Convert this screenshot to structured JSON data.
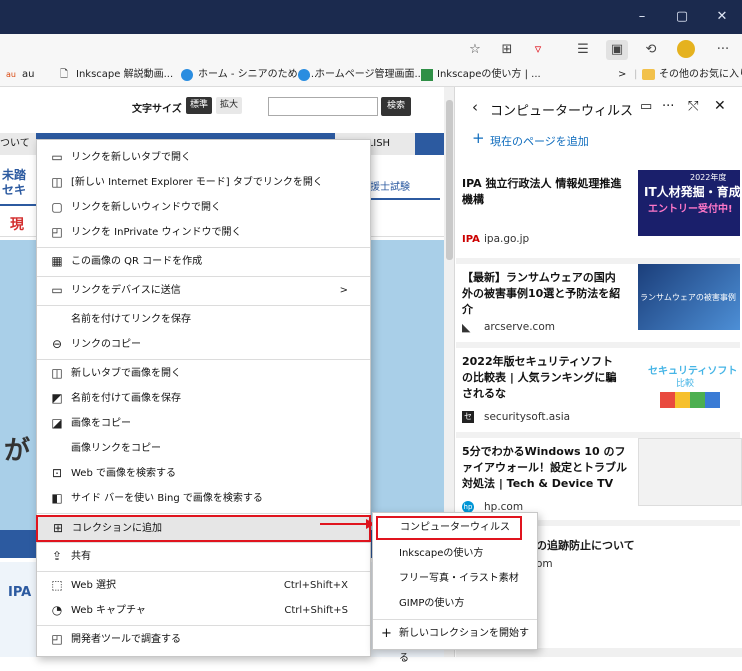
{
  "titlebar": {
    "minimize": "–",
    "restore": "▢",
    "close": "✕"
  },
  "toolbar": {
    "icons": [
      "favorite-star-icon",
      "apps-icon",
      "pocket-icon",
      "favorites-list-icon",
      "collections-icon",
      "history-icon",
      "profile-icon",
      "more-icon"
    ],
    "more": "···"
  },
  "favorites": {
    "items": [
      {
        "label": "au"
      },
      {
        "label": "Inkscape 解説動画..."
      },
      {
        "label": "ホーム - シニアのための..."
      },
      {
        "label": "ホームページ管理画面..."
      },
      {
        "label": "Inkscapeの使い方 | ..."
      }
    ],
    "chevron": ">",
    "other": "その他のお気に入り"
  },
  "page": {
    "font_size_label": "文字サイズ",
    "std": "標準",
    "large": "拡大",
    "search": "検索",
    "nav_left": "ついて",
    "nav_english": "ENGLISH",
    "left_frag1": "未踏",
    "left_frag2": "セキ",
    "left_frag3": "現",
    "left_frag4": "が",
    "right_frag1": "GLISH",
    "right_frag2": "援士試験",
    "ipa_frag": "IPA"
  },
  "panel": {
    "title": "コンピューターウィルス",
    "add_page": "現在のページを追加",
    "cards": [
      {
        "title": "IPA 独立行政法人 情報処理推進機構",
        "source": "ipa.go.jp",
        "img_text1": "2022年度",
        "img_text2": "IT人材発掘・育成",
        "img_text3": "エントリー受付中!"
      },
      {
        "title": "【最新】ランサムウェアの国内外の被害事例10選と予防法を紹介",
        "source": "arcserve.com",
        "img_text1": "ランサムウェアの被害事例"
      },
      {
        "title": "2022年版セキュリティソフトの比較表 | 人気ランキングに騙されるな",
        "source": "securitysoft.asia",
        "img_text1": "セキュリティソフト",
        "img_text2": "比較"
      },
      {
        "title": "5分でわかるWindows 10 のファイアウォール！設定とトラブル対処法 | Tech & Device TV",
        "source": "hp.com"
      },
      {
        "title": "の追跡防止について",
        "source": "om"
      }
    ]
  },
  "menu": {
    "items": [
      {
        "icon": "new-tab-icon",
        "label": "リンクを新しいタブで開く"
      },
      {
        "icon": "ie-mode-icon",
        "label": "[新しい Internet Explorer モード] タブでリンクを開く"
      },
      {
        "icon": "new-window-icon",
        "label": "リンクを新しいウィンドウで開く"
      },
      {
        "icon": "inprivate-icon",
        "label": "リンクを InPrivate ウィンドウで開く"
      },
      {
        "icon": "qr-code-icon",
        "label": "この画像の QR コードを作成"
      },
      {
        "icon": "send-device-icon",
        "label": "リンクをデバイスに送信",
        "arrow": ">"
      },
      {
        "icon": "",
        "label": "名前を付けてリンクを保存"
      },
      {
        "icon": "link-icon",
        "label": "リンクのコピー"
      },
      {
        "icon": "image-tab-icon",
        "label": "新しいタブで画像を開く"
      },
      {
        "icon": "save-image-icon",
        "label": "名前を付けて画像を保存"
      },
      {
        "icon": "copy-image-icon",
        "label": "画像をコピー"
      },
      {
        "icon": "",
        "label": "画像リンクをコピー"
      },
      {
        "icon": "web-search-image-icon",
        "label": "Web で画像を検索する"
      },
      {
        "icon": "sidebar-bing-icon",
        "label": "サイド バーを使い Bing で画像を検索する"
      },
      {
        "icon": "collections-add-icon",
        "label": "コレクションに追加"
      },
      {
        "icon": "share-icon",
        "label": "共有"
      },
      {
        "icon": "web-select-icon",
        "label": "Web 選択",
        "shortcut": "Ctrl+Shift+X"
      },
      {
        "icon": "web-capture-icon",
        "label": "Web キャプチャ",
        "shortcut": "Ctrl+Shift+S"
      },
      {
        "icon": "devtools-icon",
        "label": "開発者ツールで調査する"
      }
    ]
  },
  "submenu": {
    "items": [
      {
        "label": "コンピューターウィルス"
      },
      {
        "label": "Inkscapeの使い方"
      },
      {
        "label": "フリー写真・イラスト素材"
      },
      {
        "label": "GIMPの使い方"
      },
      {
        "label": "新しいコレクションを開始する",
        "icon": "+"
      }
    ]
  },
  "colors": {
    "highlight": "#e0141e",
    "accent": "#0f6cbd",
    "titlebar": "#1b2a4e"
  }
}
